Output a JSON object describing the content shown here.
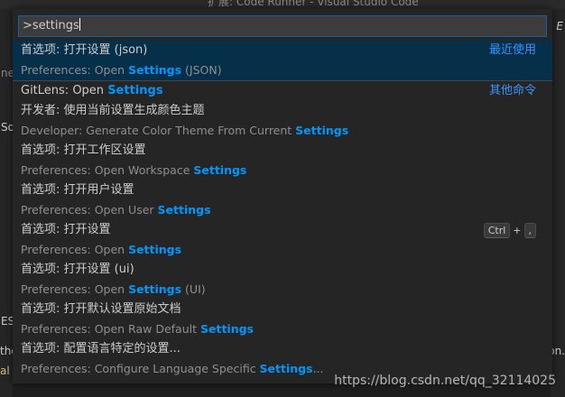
{
  "window": {
    "title": "扩展: Code Runner - Visual Studio Code"
  },
  "palette": {
    "input_value": ">settings",
    "items": [
      {
        "label": "首选项: 打开设置 (json)",
        "detail_pre": "Preferences: Open ",
        "detail_hl": "Settings",
        "detail_post": " (JSON)",
        "group": "最近使用",
        "selected": true
      },
      {
        "label_pre": "GitLens: Open ",
        "label_hl": "Settings",
        "group": "其他命令"
      },
      {
        "label": "开发者: 使用当前设置生成颜色主题",
        "detail_pre": "Developer: Generate Color Theme From Current ",
        "detail_hl": "Settings",
        "detail_post": ""
      },
      {
        "label": "首选项: 打开工作区设置",
        "detail_pre": "Preferences: Open Workspace ",
        "detail_hl": "Settings",
        "detail_post": ""
      },
      {
        "label": "首选项: 打开用户设置",
        "detail_pre": "Preferences: Open User ",
        "detail_hl": "Settings",
        "detail_post": ""
      },
      {
        "label": "首选项: 打开设置",
        "detail_pre": "Preferences: Open ",
        "detail_hl": "Settings",
        "detail_post": "",
        "keybinding": [
          "Ctrl",
          "+",
          ","
        ]
      },
      {
        "label": "首选项: 打开设置 (ui)",
        "detail_pre": "Preferences: Open ",
        "detail_hl": "Settings",
        "detail_post": " (UI)"
      },
      {
        "label": "首选项: 打开默认设置原始文档",
        "detail_pre": "Preferences: Open Raw Default ",
        "detail_hl": "Settings",
        "detail_post": ""
      },
      {
        "label": "首选项: 配置语言特定的设置...",
        "detail_pre": "Preferences: Configure Language Specific ",
        "detail_hl": "Settings",
        "detail_post": "..."
      }
    ]
  },
  "background": {
    "left_fragments": [
      "ne",
      "So",
      "ES",
      "the",
      "al"
    ],
    "right_fragments": [
      "E",
      "on."
    ]
  },
  "watermark": "https://blog.csdn.net/qq_32114025",
  "colors": {
    "accent": "#0097fb",
    "selection": "#062f4a",
    "group_label": "#3794ff"
  }
}
